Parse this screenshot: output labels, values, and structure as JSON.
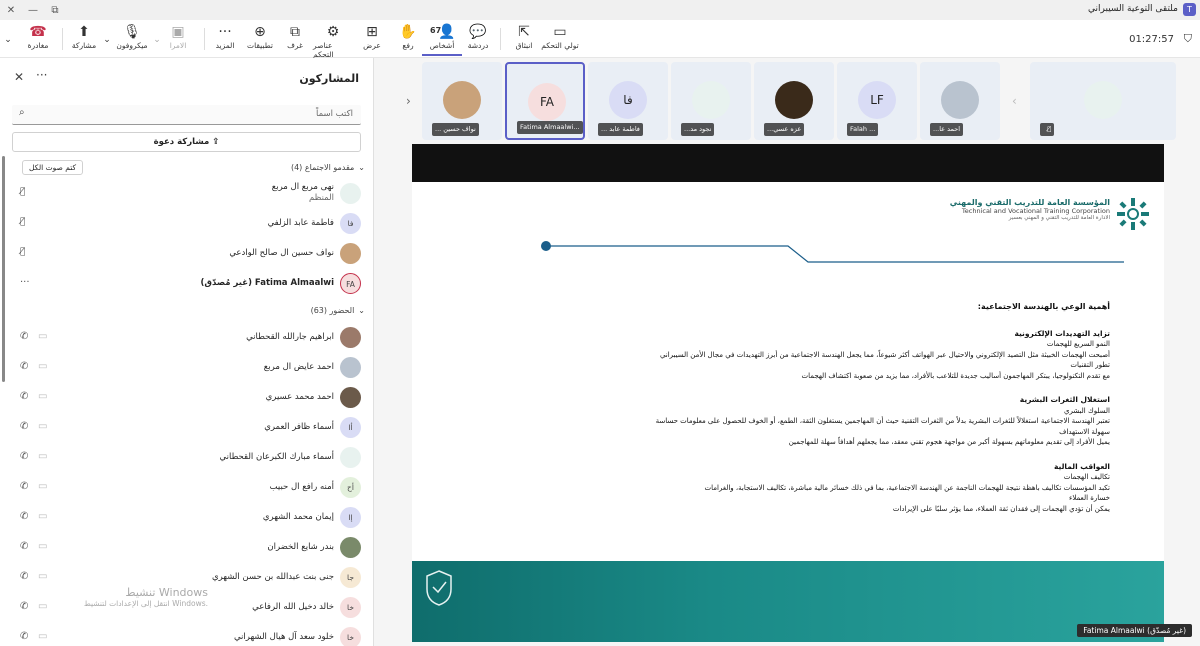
{
  "window": {
    "title": "ملتقى التوعية السيبراني",
    "time": "01:27:57"
  },
  "toolbar": {
    "leave": "مغادرة",
    "share": "مشاركة",
    "mic": "ميكروفون",
    "camera": "الامرا",
    "more": "المزيد",
    "apps": "تطبيقات",
    "rooms": "غرف",
    "controls": "عناصر التحكم",
    "view": "عرض",
    "raise": "رفع",
    "people": "أشخاص",
    "people_count": "67",
    "chat": "دردشة",
    "react": "انبثاق",
    "take_control": "تولي التحكم"
  },
  "panel": {
    "title": "المشاركون",
    "search_placeholder": "اكتب اسماً",
    "share_invite": "مشاركة دعوة",
    "mute_all": "كتم صوت الكل",
    "presenters_header": "مقدمو الاجتماع (4)",
    "attendees_header": "الحضور (63)",
    "presenters": [
      {
        "name": "نهى مربع ال مربع",
        "sub": "المنظم",
        "initials": "",
        "color": "#e8f2ef"
      },
      {
        "name": "فاطمة عابد الزلفي",
        "initials": "فا",
        "color": "#d9dcf5"
      },
      {
        "name": "نواف حسين ال صالح الوادعي",
        "initials": "",
        "color": "#c9a27a"
      },
      {
        "name": "Fatima Almaalwi (غير مُصدّق)",
        "initials": "FA",
        "color": "#f6dede"
      }
    ],
    "attendees": [
      {
        "name": "ابراهيم جارالله القحطاني",
        "initials": "",
        "color": "#9b7a6a"
      },
      {
        "name": "احمد عايض ال مربع",
        "initials": "",
        "color": "#b9c3cf"
      },
      {
        "name": "احمد محمد عسيري",
        "initials": "",
        "color": "#6b5a4a"
      },
      {
        "name": "أسماء ظافر العمري",
        "initials": "أا",
        "color": "#d9dcf5"
      },
      {
        "name": "أسماء مبارك الكبرعان القحطاني",
        "initials": "",
        "color": "#e8f2ef"
      },
      {
        "name": "أمنه رافع ال حبيب",
        "initials": "أح",
        "color": "#e3f0dc"
      },
      {
        "name": "إيمان محمد الشهري",
        "initials": "إا",
        "color": "#d9dcf5"
      },
      {
        "name": "بندر شايع الخضران",
        "initials": "",
        "color": "#7a8a6a"
      },
      {
        "name": "جنى بنت عبدالله بن حسن الشهري",
        "initials": "جا",
        "color": "#f6e9d4"
      },
      {
        "name": "خالد دخيل الله الرفاعي",
        "initials": "خا",
        "color": "#f6dede"
      },
      {
        "name": "خلود سعد آل هيال الشهراني",
        "initials": "خا",
        "color": "#f6dede"
      }
    ],
    "activate": {
      "title": "تنشيط Windows",
      "sub": "انتقل إلى الإعدادات لتنشيط Windows."
    }
  },
  "gallery": [
    {
      "label": "نواف حسين ...",
      "initials": "",
      "color": "#c9a27a"
    },
    {
      "label": "Fatima Almaalwi...",
      "initials": "FA",
      "color": "#f6dede",
      "selected": true
    },
    {
      "label": "فاطمة عابد ...",
      "initials": "فا",
      "color": "#d9dcf5"
    },
    {
      "label": "نجود مد...",
      "initials": "",
      "color": "#e8f2ef"
    },
    {
      "label": "عزه عسي...",
      "initials": "",
      "color": "#3a2a1a"
    },
    {
      "label": "Falah ...",
      "initials": "LF",
      "color": "#d9dcf5"
    },
    {
      "label": "احمد عا...",
      "initials": "",
      "color": "#b9c3cf"
    },
    {
      "label": "",
      "initials": "",
      "color": "#e8f2ef"
    }
  ],
  "slide": {
    "org_ar": "المؤسسة العامة للتدريب التقني والمهني",
    "org_en": "Technical and Vocational Training Corporation",
    "org_sub": "الادارة العامة للتدريب التقني و المهني بعسير",
    "heading": "أهمية الوعي بالهندسة الاجتماعية:",
    "sections": [
      {
        "title": "تزايد التهديدات الإلكترونية",
        "lines": [
          "النمو السريع للهجمات",
          "أصبحت الهجمات الخبيثة مثل التصيد الإلكتروني والاحتيال عبر الهواتف أكثر شيوعاً، مما يجعل الهندسة الاجتماعية من أبرز التهديدات في مجال الأمن السيبراني",
          "تطور التقنيات",
          "مع تقدم التكنولوجيا، يبتكر المهاجمون أساليب جديدة للتلاعب بالأفراد، مما يزيد من صعوبة اكتشاف الهجمات"
        ]
      },
      {
        "title": "استغلال الثغرات البشرية",
        "lines": [
          "السلوك البشري",
          "تعتبر الهندسة الاجتماعية استغلالاً للثغرات البشرية بدلاً من الثغرات التقنية  حيث أن المهاجمين يستغلون الثقة، الطمع، أو الخوف للحصول على معلومات حساسة",
          "سهولة الاستهداف",
          "يميل الأفراد إلى تقديم معلوماتهم بسهولة أكبر من مواجهة هجوم تقني معقد، مما يجعلهم أهدافاً سهلة للمهاجمين"
        ]
      },
      {
        "title": "العواقب المالية",
        "lines": [
          "تكاليف الهجمات",
          "تكبد المؤسسات تكاليف باهظة نتيجة للهجمات الناجمة عن الهندسة الاجتماعية، بما في ذلك خسائر مالية مباشرة، تكاليف الاستجابة، والغرامات",
          "خسارة العملاء",
          "يمكن أن تؤدي الهجمات إلى فقدان ثقة العملاء، مما يؤثر سلبًا على الإيرادات"
        ]
      }
    ],
    "presenter_tag": "Fatima Almaalwi (غير مُصدّق)"
  }
}
